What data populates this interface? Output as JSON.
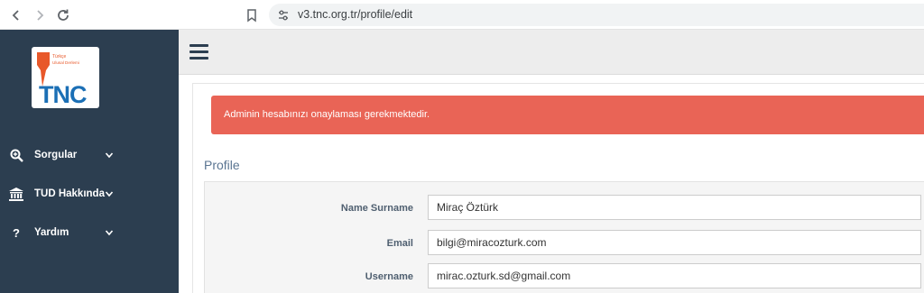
{
  "browser": {
    "url": "v3.tnc.org.tr/profile/edit"
  },
  "logo": {
    "line1": "Türkçe",
    "line2": "Ulusal Derlemi",
    "mark": "TNC",
    "accent_color": "#e8582a",
    "brand_color": "#1b6fb5"
  },
  "sidebar": {
    "items": [
      {
        "label": "Sorgular",
        "icon": "search-plus-icon"
      },
      {
        "label": "TUD Hakkında",
        "icon": "institution-icon"
      },
      {
        "label": "Yardım",
        "icon": "question-icon"
      }
    ]
  },
  "alert": {
    "message": "Adminin hesabınızı onaylaması gerekmektedir."
  },
  "profile": {
    "title": "Profile",
    "fields": [
      {
        "label": "Name Surname",
        "value": "Miraç Öztürk"
      },
      {
        "label": "Email",
        "value": "bilgi@miracozturk.com"
      },
      {
        "label": "Username",
        "value": "mirac.ozturk.sd@gmail.com"
      }
    ]
  }
}
